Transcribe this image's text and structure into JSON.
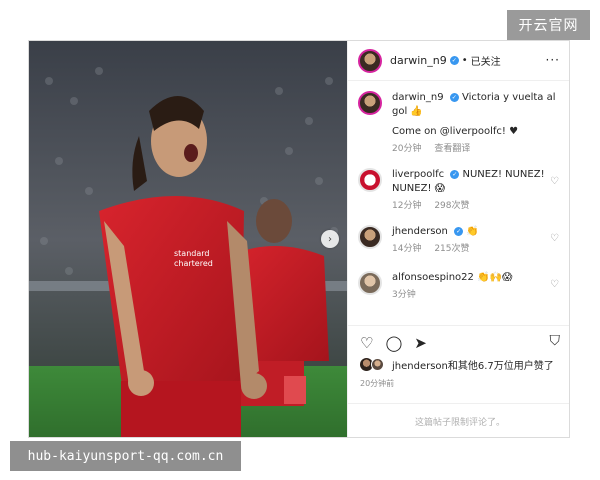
{
  "watermark_top": "开云官网",
  "watermark_bottom": "hub-kaiyunsport-qq.com.cn",
  "post": {
    "author": "darwin_n9",
    "follow_state": "已关注",
    "separator": "•",
    "more_label": "···",
    "photo_alt": "Player celebrating goal in red kit",
    "next_label": "›"
  },
  "caption": {
    "user": "darwin_n9",
    "text": "Victoria y vuelta al gol 👍",
    "line2": "Come on @liverpoolfc! ♥",
    "time": "20分钟",
    "translate": "查看翻译"
  },
  "comments": [
    {
      "user": "liverpoolfc",
      "verified": true,
      "text": "NUNEZ! NUNEZ! NUNEZ! 😱",
      "time": "12分钟",
      "likes": "298次赞"
    },
    {
      "user": "jhenderson",
      "verified": true,
      "text": "👏",
      "time": "14分钟",
      "likes": "215次赞"
    },
    {
      "user": "alfonsoespino22",
      "verified": false,
      "text": "👏🙌😱",
      "time": "3分钟",
      "likes": ""
    }
  ],
  "actions": {
    "like_icon": "♡",
    "comment_icon": "◯",
    "share_icon": "➤",
    "save_icon": "⛉"
  },
  "likes_text": "jhenderson和其他6.7万位用户赞了",
  "post_time": "20分钟前",
  "comments_limited": "这篇帖子限制评论了。"
}
